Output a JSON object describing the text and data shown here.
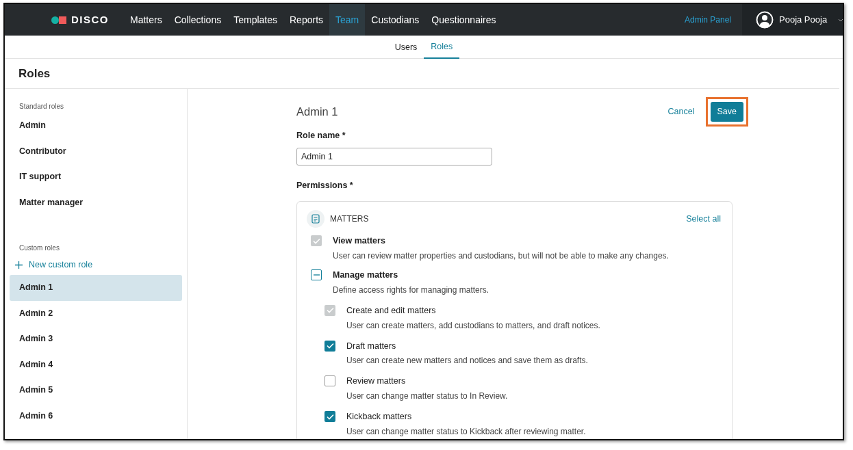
{
  "navbar": {
    "logo": "DISCO",
    "items": [
      {
        "label": "Matters",
        "selected": false
      },
      {
        "label": "Collections",
        "selected": false
      },
      {
        "label": "Templates",
        "selected": false
      },
      {
        "label": "Reports",
        "selected": false
      },
      {
        "label": "Team",
        "selected": true
      },
      {
        "label": "Custodians",
        "selected": false
      },
      {
        "label": "Questionnaires",
        "selected": false
      }
    ],
    "admin_link": "Admin Panel",
    "user": {
      "name": "Pooja Pooja"
    }
  },
  "subtabs": [
    {
      "label": "Users",
      "selected": false
    },
    {
      "label": "Roles",
      "selected": true
    }
  ],
  "page_title": "Roles",
  "sidebar": {
    "sections": [
      {
        "heading": "Standard roles",
        "items": [
          {
            "label": "Admin",
            "selected": false
          },
          {
            "label": "Contributor",
            "selected": false
          },
          {
            "label": "IT support",
            "selected": false
          },
          {
            "label": "Matter manager",
            "selected": false
          }
        ]
      },
      {
        "heading": "Custom roles",
        "new_link": "New custom role",
        "items": [
          {
            "label": "Admin 1",
            "selected": true
          },
          {
            "label": "Admin 2",
            "selected": false
          },
          {
            "label": "Admin 3",
            "selected": false
          },
          {
            "label": "Admin 4",
            "selected": false
          },
          {
            "label": "Admin 5",
            "selected": false
          },
          {
            "label": "Admin 6",
            "selected": false
          }
        ]
      }
    ]
  },
  "editor": {
    "title": "Admin 1",
    "cancel": "Cancel",
    "save": "Save",
    "save_highlighted": true,
    "role_name_label": "Role name *",
    "role_name_value": "Admin 1",
    "permissions_label": "Permissions *",
    "group": {
      "title": "MATTERS",
      "select_all": "Select all",
      "permissions": [
        {
          "label": "View matters",
          "description": "User can review matter properties and custodians, but will not be able to make any changes.",
          "checked": true,
          "indeterminate": false,
          "disabled": true
        },
        {
          "label": "Manage matters",
          "description": "Define access rights for managing matters.",
          "indeterminate": true,
          "disabled": false,
          "children": [
            {
              "label": "Create and edit matters",
              "description": "User can create matters, add custodians to matters, and draft notices.",
              "checked": true,
              "indeterminate": false,
              "disabled": true
            },
            {
              "label": "Draft matters",
              "description": "User can create new matters and notices and save them as drafts.",
              "checked": true,
              "indeterminate": false,
              "disabled": false
            },
            {
              "label": "Review matters",
              "description": "User can change matter status to In Review.",
              "checked": false,
              "indeterminate": false,
              "disabled": false
            },
            {
              "label": "Kickback matters",
              "description": "User can change matter status to Kickback after reviewing matter.",
              "checked": true,
              "indeterminate": false,
              "disabled": false
            }
          ]
        }
      ]
    }
  }
}
